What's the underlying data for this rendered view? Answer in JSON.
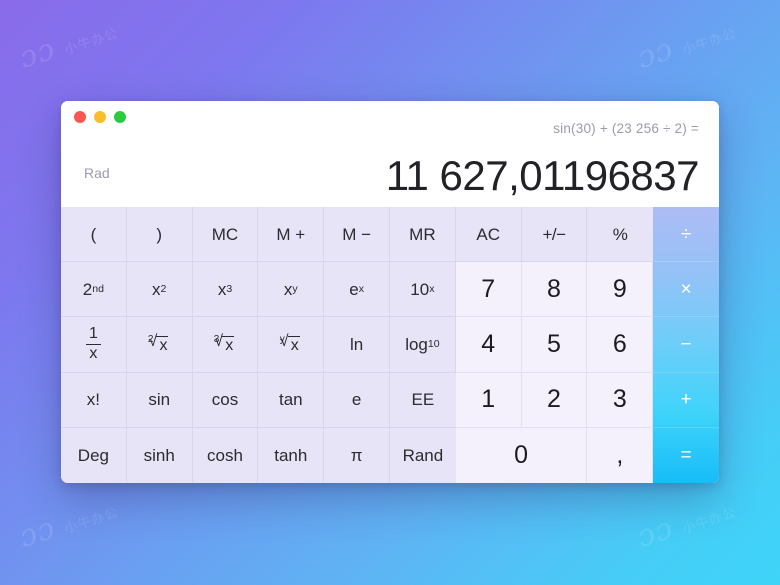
{
  "window": {
    "traffic_lights": [
      {
        "name": "close",
        "color": "#f8584f"
      },
      {
        "name": "minimize",
        "color": "#fbbc2e"
      },
      {
        "name": "maximize",
        "color": "#2ccb3f"
      }
    ]
  },
  "display": {
    "expression": "sin(30) + (23 256 ÷ 2) =",
    "result": "11 627,01196837",
    "angle_mode": "Rad"
  },
  "keypad": {
    "rows": [
      [
        {
          "label": "(",
          "type": "fn"
        },
        {
          "label": ")",
          "type": "fn"
        },
        {
          "label": "MC",
          "type": "fn"
        },
        {
          "label": "M +",
          "type": "fn"
        },
        {
          "label": "M −",
          "type": "fn"
        },
        {
          "label": "MR",
          "type": "fn"
        },
        {
          "label": "AC",
          "type": "fn"
        },
        {
          "label": "+/−",
          "type": "fn"
        },
        {
          "label": "%",
          "type": "fn"
        },
        {
          "label": "÷",
          "type": "op"
        }
      ],
      [
        {
          "label": "2nd",
          "type": "fn"
        },
        {
          "label": "x²",
          "type": "fn"
        },
        {
          "label": "x³",
          "type": "fn"
        },
        {
          "label": "xʸ",
          "type": "fn"
        },
        {
          "label": "eˣ",
          "type": "fn"
        },
        {
          "label": "10ˣ",
          "type": "fn"
        },
        {
          "label": "7",
          "type": "num"
        },
        {
          "label": "8",
          "type": "num"
        },
        {
          "label": "9",
          "type": "num"
        },
        {
          "label": "×",
          "type": "op"
        }
      ],
      [
        {
          "label": "1/x",
          "type": "fn"
        },
        {
          "label": "²√x",
          "type": "fn"
        },
        {
          "label": "³√x",
          "type": "fn"
        },
        {
          "label": "ʸ√x",
          "type": "fn"
        },
        {
          "label": "ln",
          "type": "fn"
        },
        {
          "label": "log10",
          "type": "fn"
        },
        {
          "label": "4",
          "type": "num"
        },
        {
          "label": "5",
          "type": "num"
        },
        {
          "label": "6",
          "type": "num"
        },
        {
          "label": "−",
          "type": "op"
        }
      ],
      [
        {
          "label": "x!",
          "type": "fn"
        },
        {
          "label": "sin",
          "type": "fn"
        },
        {
          "label": "cos",
          "type": "fn"
        },
        {
          "label": "tan",
          "type": "fn"
        },
        {
          "label": "e",
          "type": "fn"
        },
        {
          "label": "EE",
          "type": "fn"
        },
        {
          "label": "1",
          "type": "num"
        },
        {
          "label": "2",
          "type": "num"
        },
        {
          "label": "3",
          "type": "num"
        },
        {
          "label": "+",
          "type": "op"
        }
      ],
      [
        {
          "label": "Deg",
          "type": "fn"
        },
        {
          "label": "sinh",
          "type": "fn"
        },
        {
          "label": "cosh",
          "type": "fn"
        },
        {
          "label": "tanh",
          "type": "fn"
        },
        {
          "label": "π",
          "type": "fn"
        },
        {
          "label": "Rand",
          "type": "fn"
        },
        {
          "label": "0",
          "type": "num"
        },
        {
          "label": ",",
          "type": "num"
        },
        {
          "label": "=",
          "type": "op"
        }
      ]
    ]
  },
  "wallpaper": {
    "watermark_mark": "ɔɔ",
    "watermark_text": "小牛办公"
  },
  "colors": {
    "bg_start": "#8a6bea",
    "bg_end": "#3ed4f8",
    "fn_key": "#e8e4f7",
    "num_key": "#f4f1fd",
    "op_top": "#aebcf5",
    "op_bottom": "#17bdf8",
    "result_text": "#222226",
    "muted_text": "#9b9bab"
  }
}
